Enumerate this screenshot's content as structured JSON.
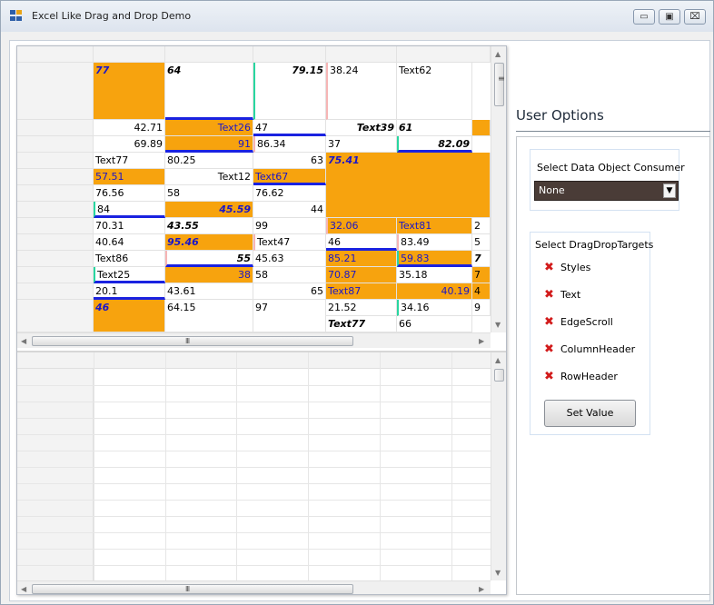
{
  "window": {
    "title": "Excel Like Drag and Drop Demo",
    "minimize_glyph": "▭",
    "maximize_glyph": "▣",
    "close_glyph": "⌧"
  },
  "grid": {
    "rows": [
      [
        "77",
        "64",
        "79.15",
        "38.24",
        "Text62"
      ],
      [
        "42.71",
        "Text26",
        "47",
        "Text39",
        "61"
      ],
      [
        "69.89",
        "91",
        "86.34",
        "37",
        "82.09"
      ],
      [
        "Text77",
        "80.25",
        "63",
        "75.41",
        ""
      ],
      [
        "57.51",
        "Text12",
        "Text67",
        "",
        ""
      ],
      [
        "76.56",
        "58",
        "76.62",
        "",
        ""
      ],
      [
        "84",
        "45.59",
        "44",
        "32.06",
        "Text81",
        "2"
      ],
      [
        "70.31",
        "43.55",
        "99",
        "46",
        "83.49",
        "5"
      ],
      [
        "40.64",
        "95.46",
        "Text47",
        "85.21",
        "59.83",
        "7"
      ],
      [
        "Text86",
        "55",
        "45.63",
        "70.87",
        "35.18",
        "7"
      ],
      [
        "Text25",
        "38",
        "58",
        "Text87",
        "40.19",
        "4"
      ],
      [
        "20.1",
        "43.61",
        "65",
        "21.52",
        "34.16",
        "9"
      ],
      [
        "46",
        "64.15",
        "97",
        "Text77",
        "66",
        ""
      ]
    ],
    "scroll_grip": "III",
    "scrollbar_up": "▲",
    "scrollbar_down": "▼",
    "scrollbar_left": "◀",
    "scrollbar_right": "▶"
  },
  "options": {
    "title": "User Options",
    "consumer_label": "Select Data Object Consumer",
    "consumer_value": "None",
    "dd_glyph": "▼",
    "targets_label": "Select DragDropTargets",
    "targets": [
      "Styles",
      "Text",
      "EdgeScroll",
      "ColumnHeader",
      "RowHeader"
    ],
    "check_glyph": "✖",
    "button_label": "Set Value"
  },
  "colors": {
    "orange": "#f7a30e",
    "blue_text": "#1a16c8",
    "border_blue": "#1a22e0"
  }
}
